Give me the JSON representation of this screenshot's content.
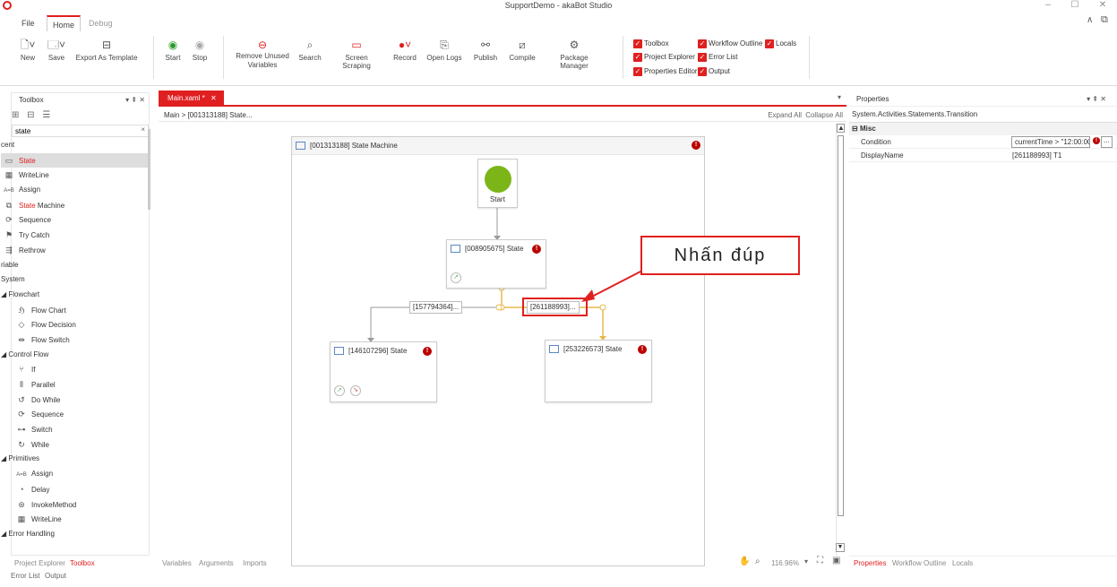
{
  "window": {
    "title": "SupportDemo - akaBot Studio",
    "controls": [
      "–",
      "☐",
      "✕"
    ]
  },
  "menu_tabs": [
    {
      "label": "File"
    },
    {
      "label": "Home"
    },
    {
      "label": "Debug"
    }
  ],
  "ribbon": {
    "buttons": [
      {
        "label": "New",
        "icon": "new-icon"
      },
      {
        "label": "Save",
        "icon": "save-icon"
      },
      {
        "label": "Export As Template",
        "icon": "export-template-icon"
      },
      {
        "label": "Start",
        "icon": "start-icon"
      },
      {
        "label": "Stop",
        "icon": "stop-icon"
      },
      {
        "label": "Remove Unused Variables",
        "icon": "remove-variables-icon"
      },
      {
        "label": "Search",
        "icon": "search-icon"
      },
      {
        "label": "Screen Scraping",
        "icon": "screen-scraping-icon"
      },
      {
        "label": "Record",
        "icon": "record-icon"
      },
      {
        "label": "Open Logs",
        "icon": "open-logs-icon"
      },
      {
        "label": "Publish",
        "icon": "publish-icon"
      },
      {
        "label": "Compile",
        "icon": "compile-icon"
      },
      {
        "label": "Package Manager",
        "icon": "package-manager-icon"
      }
    ],
    "checkboxes": [
      {
        "label": "Toolbox",
        "checked": true
      },
      {
        "label": "Workflow Outline",
        "checked": true
      },
      {
        "label": "Locals",
        "checked": true
      },
      {
        "label": "Project Explorer",
        "checked": true
      },
      {
        "label": "Error List",
        "checked": true
      },
      {
        "label": "Properties Editor",
        "checked": true
      },
      {
        "label": "Output",
        "checked": true
      }
    ]
  },
  "toolbox": {
    "title": "Toolbox",
    "pin_controls": "▾ ⇞ ✕",
    "search_value": "state",
    "items": [
      {
        "label": "cent",
        "type": "group"
      },
      {
        "label_hl": "State",
        "label_rest": "",
        "type": "item",
        "icon": "state-icon",
        "selected": true
      },
      {
        "label": "WriteLine",
        "type": "item",
        "icon": "writeline-icon"
      },
      {
        "label": "Assign",
        "type": "item",
        "icon": "assign-icon"
      },
      {
        "label_hl": "State",
        "label_rest": " Machine",
        "type": "item",
        "icon": "state-machine-icon"
      },
      {
        "label": "Sequence",
        "type": "item",
        "icon": "sequence-icon"
      },
      {
        "label": "Try Catch",
        "type": "item",
        "icon": "try-catch-icon"
      },
      {
        "label": "Rethrow",
        "type": "item",
        "icon": "rethrow-icon"
      },
      {
        "label": "riable",
        "type": "group"
      },
      {
        "label": "System",
        "type": "group"
      },
      {
        "label": "◢ Flowchart",
        "type": "group"
      },
      {
        "label": "Flow Chart",
        "type": "sub",
        "icon": "flow-chart-icon"
      },
      {
        "label": "Flow Decision",
        "type": "sub",
        "icon": "flow-decision-icon"
      },
      {
        "label": "Flow Switch",
        "type": "sub",
        "icon": "flow-switch-icon"
      },
      {
        "label": "◢ Control Flow",
        "type": "group"
      },
      {
        "label": "If",
        "type": "sub",
        "icon": "if-icon"
      },
      {
        "label": "Parallel",
        "type": "sub",
        "icon": "parallel-icon"
      },
      {
        "label": "Do While",
        "type": "sub",
        "icon": "do-while-icon"
      },
      {
        "label": "Sequence",
        "type": "sub",
        "icon": "sequence-icon"
      },
      {
        "label": "Switch",
        "type": "sub",
        "icon": "switch-icon"
      },
      {
        "label": "While",
        "type": "sub",
        "icon": "while-icon"
      },
      {
        "label": "◢ Primitives",
        "type": "group"
      },
      {
        "label": "Assign",
        "type": "sub",
        "icon": "assign-icon"
      },
      {
        "label": "Delay",
        "type": "sub",
        "icon": "delay-icon"
      },
      {
        "label": "InvokeMethod",
        "type": "sub",
        "icon": "invoke-method-icon"
      },
      {
        "label": "WriteLine",
        "type": "sub",
        "icon": "writeline-icon"
      },
      {
        "label": "◢ Error Handling",
        "type": "group"
      },
      {
        "label": "Rethrow",
        "type": "sub",
        "icon": "rethrow-icon"
      }
    ],
    "bottom_tabs": [
      "Project Explorer",
      "Toolbox"
    ],
    "bottom_tabs_2": [
      "Error List",
      "Output"
    ]
  },
  "designer": {
    "tab_label": "Main.xaml *",
    "breadcrumb": "Main  >  [001313188] State...",
    "expand_all": "Expand All",
    "collapse_all": "Collapse All",
    "state_machine_title": "[001313188] State Machine",
    "start_label": "Start",
    "state_top": "[008905675] State",
    "state_left": "[146107296] State",
    "state_right": "[253226573] State",
    "transition_left": "[157794364]...",
    "transition_right": "[261188993]...",
    "annotation": "Nhấn đúp",
    "bottom_tabs": [
      "Variables",
      "Arguments",
      "Imports"
    ],
    "zoom": "116.96%"
  },
  "properties": {
    "title": "Properties",
    "pin_controls": "▾ ⇞ ✕",
    "type_name": "System.Activities.Statements.Transition",
    "category": "Misc",
    "rows": [
      {
        "name": "Condition",
        "value": "currentTime > \"12:00:00"
      },
      {
        "name": "DisplayName",
        "value": "[261188993] T1"
      }
    ],
    "bottom_tabs": [
      "Properties",
      "Workflow Outline",
      "Locals"
    ]
  },
  "colors": {
    "accent": "#e02020",
    "start": "#7cb518",
    "transition": "#e8b84a"
  }
}
